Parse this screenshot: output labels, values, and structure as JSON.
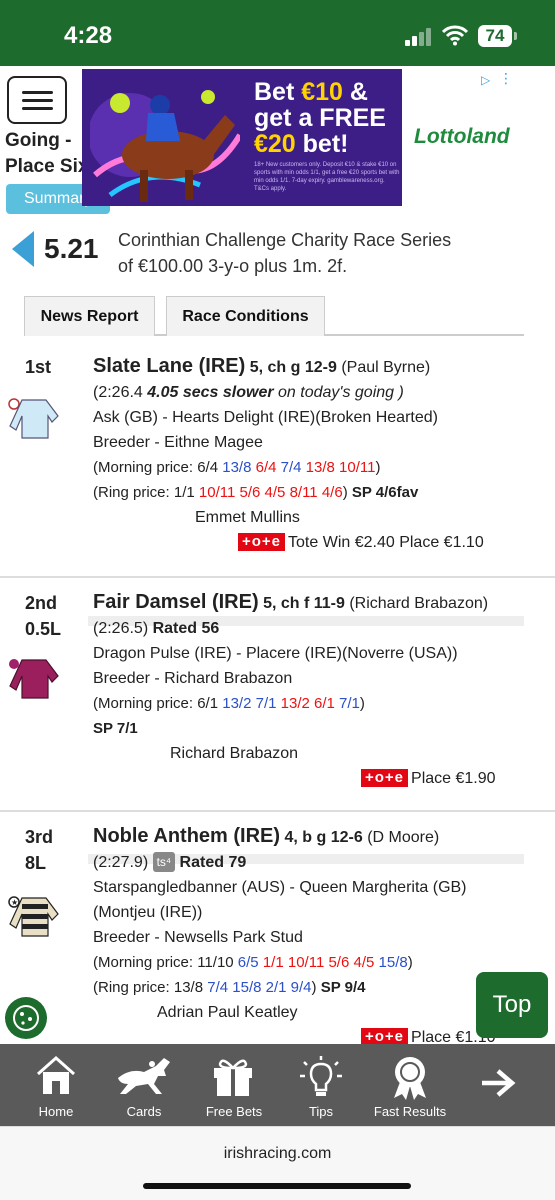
{
  "status": {
    "time": "4:28",
    "battery": "74"
  },
  "page": {
    "behind_line1": "Going - ",
    "behind_line2": "Place Six",
    "summary_label": "Summary"
  },
  "ad": {
    "line1a": "Bet ",
    "line1b": "€10",
    "line1c": " &",
    "line2": "get a FREE",
    "line3a": "€20",
    "line3b": " bet!",
    "brand": "Lottoland",
    "small": "18+ New customers only. Deposit €10 & stake €10 on sports with min odds 1/1, get a free €20 sports bet with min odds 1/1. 7-day expiry. gamblewareness.org. T&Cs apply."
  },
  "race": {
    "number": "5.21",
    "title_line1": "Corinthian Challenge Charity Race Series",
    "title_line2": "of €100.00 3-y-o plus 1m. 2f."
  },
  "tabs": [
    "News Report",
    "Race Conditions"
  ],
  "runners": [
    {
      "pos": "1st",
      "distance": "",
      "name": "Slate Lane (IRE)",
      "info": "5, ch g 12-9",
      "rider": "(Paul Byrne)",
      "time_open": "(2:26.4 ",
      "time_bold": "4.05 secs slower",
      "time_rest": " on today's going )",
      "breeding": "Ask (GB) - Hearts Delight (IRE)(Broken Hearted)",
      "breeder": "Breeder - Eithne Magee",
      "morning_label": "(Morning price: 6/4",
      "morning": [
        "13/8",
        "6/4",
        "7/4",
        "13/8",
        "10/11"
      ],
      "morning_close": ")",
      "ring_label": "(Ring price: 1/1",
      "ring": [
        "10/11",
        "5/6",
        "4/5",
        "8/11",
        "4/6"
      ],
      "ring_close": ")",
      "sp": "SP 4/6fav",
      "trainer": "Emmet Mullins",
      "tote_logo": "+o+e",
      "tote": "Tote Win €2.40 Place €1.10"
    },
    {
      "pos": "2nd",
      "distance": "0.5L",
      "name": "Fair Damsel (IRE)",
      "info": "5, ch f 11-9",
      "rider": "(Richard Brabazon)",
      "time": "(2:26.5)",
      "rated": "Rated 56",
      "breeding": "Dragon Pulse (IRE) - Placere (IRE)(Noverre (USA))",
      "breeder": "Breeder - Richard Brabazon",
      "morning_label": "(Morning price: 6/1",
      "morning": [
        "13/2",
        "7/1",
        "13/2",
        "6/1",
        "7/1"
      ],
      "morning_close": ")",
      "sp": "SP 7/1",
      "trainer": "Richard Brabazon",
      "tote_logo": "+o+e",
      "tote": "Place €1.90"
    },
    {
      "pos": "3rd",
      "distance": "8L",
      "name": "Noble Anthem (IRE)",
      "info": "4, b g 12-6",
      "rider": "(D Moore)",
      "time": "(2:27.9)",
      "ts": "ts⁴",
      "rated": "Rated 79",
      "breeding1": "Starspangledbanner (AUS) - Queen Margherita (GB)",
      "breeding2": "(Montjeu (IRE))",
      "breeder": "Breeder - Newsells Park Stud",
      "morning_label": "(Morning price: 11/10",
      "morning": [
        "6/5",
        "1/1",
        "10/11",
        "5/6",
        "4/5",
        "15/8"
      ],
      "morning_close": ")",
      "ring_label": "(Ring price: 13/8",
      "ring": [
        "7/4",
        "15/8",
        "2/1",
        "9/4"
      ],
      "ring_close": ")",
      "sp": "SP 9/4",
      "trainer": "Adrian Paul Keatley",
      "tote_logo": "+o+e",
      "tote": "Place €1.10"
    }
  ],
  "top_label": "Top",
  "nav": [
    {
      "label": "Home",
      "icon": "home-icon"
    },
    {
      "label": "Cards",
      "icon": "horse-icon"
    },
    {
      "label": "Free Bets",
      "icon": "gift-icon"
    },
    {
      "label": "Tips",
      "icon": "lightbulb-icon"
    },
    {
      "label": "Fast Results",
      "icon": "rosette-icon"
    },
    {
      "label": "",
      "icon": "arrow-right-icon"
    }
  ],
  "browser": {
    "url": "irishracing.com"
  }
}
